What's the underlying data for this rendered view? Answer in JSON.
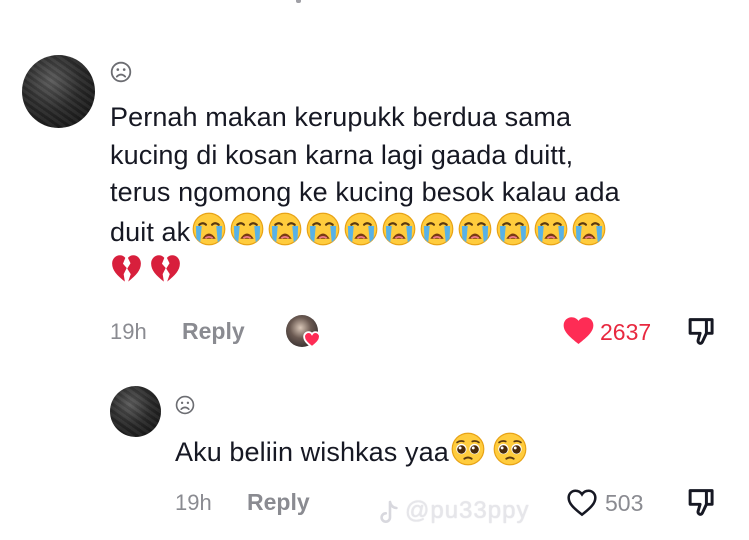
{
  "comments": [
    {
      "text_line1": "Pernah makan kerupukk berdua sama",
      "text_line2": "kucing di kosan karna lagi gaada duitt,",
      "text_line3": "terus ngomong ke kucing besok kalau ada",
      "text_line4": "duit ak",
      "emoji_crying_count": 11,
      "emoji_broken_heart_count": 2,
      "time": "19h",
      "reply_label": "Reply",
      "like_count": "2637",
      "liked": true
    }
  ],
  "replies": [
    {
      "text": "Aku beliin wishkas yaa",
      "emoji_pleading_count": 2,
      "time": "19h",
      "reply_label": "Reply",
      "like_count": "503",
      "liked": false
    }
  ],
  "watermark": "@pu33ppy",
  "colors": {
    "text": "#161823",
    "meta": "#8a8b91",
    "like_active": "#fe2c55",
    "like_count_active": "#e8283f"
  },
  "icons": [
    "sad-face-icon",
    "crying-face-icon",
    "broken-heart-icon",
    "pleading-face-icon",
    "heart-icon",
    "heart-outline-icon",
    "thumbs-down-icon",
    "tiktok-logo-icon"
  ]
}
